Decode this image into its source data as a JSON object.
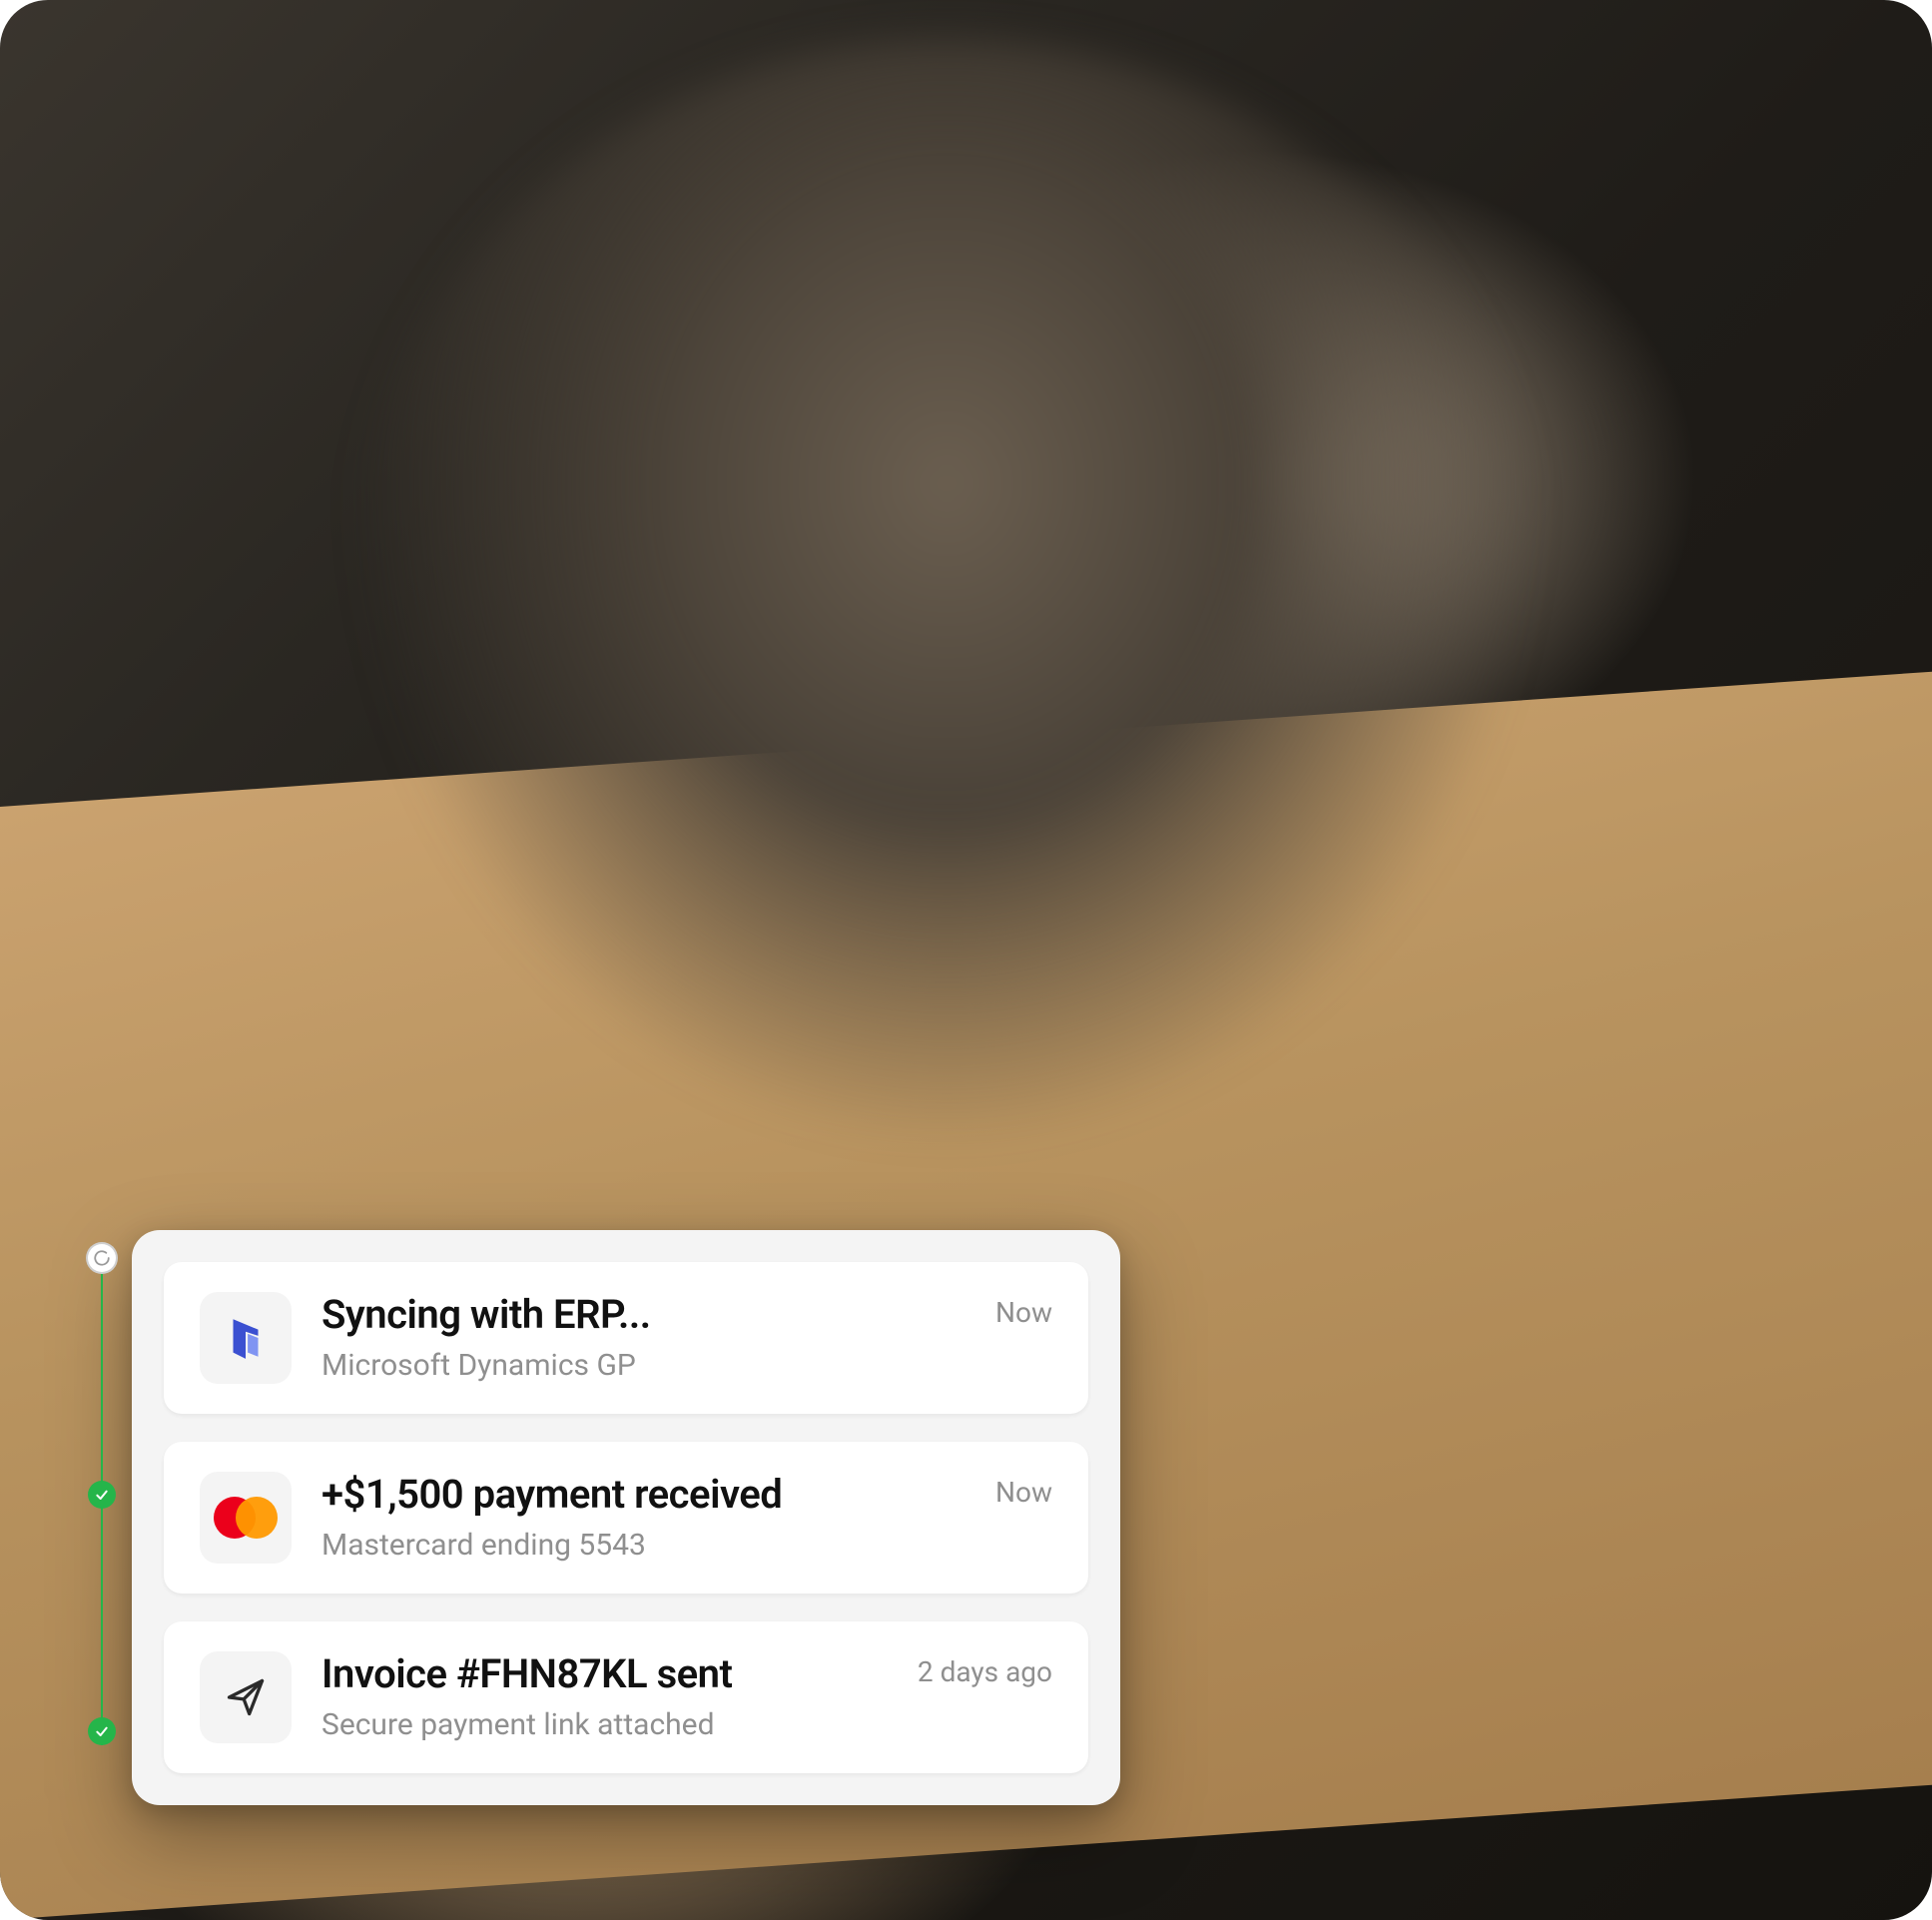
{
  "timeline": {
    "items": [
      {
        "icon": "dynamics-logo-icon",
        "status": "syncing",
        "title": "Syncing with ERP...",
        "subtitle": "Microsoft Dynamics GP",
        "time": "Now"
      },
      {
        "icon": "mastercard-icon",
        "status": "done",
        "title": "+$1,500 payment received",
        "subtitle": "Mastercard ending 5543",
        "time": "Now"
      },
      {
        "icon": "send-icon",
        "status": "done",
        "title": "Invoice #FHN87KL sent",
        "subtitle": "Secure payment link attached",
        "time": "2 days ago"
      }
    ]
  },
  "colors": {
    "accent_green": "#25b54a",
    "text_primary": "#111111",
    "text_muted": "#8f8f8f",
    "panel_bg": "#f4f4f4",
    "card_bg": "#ffffff"
  }
}
